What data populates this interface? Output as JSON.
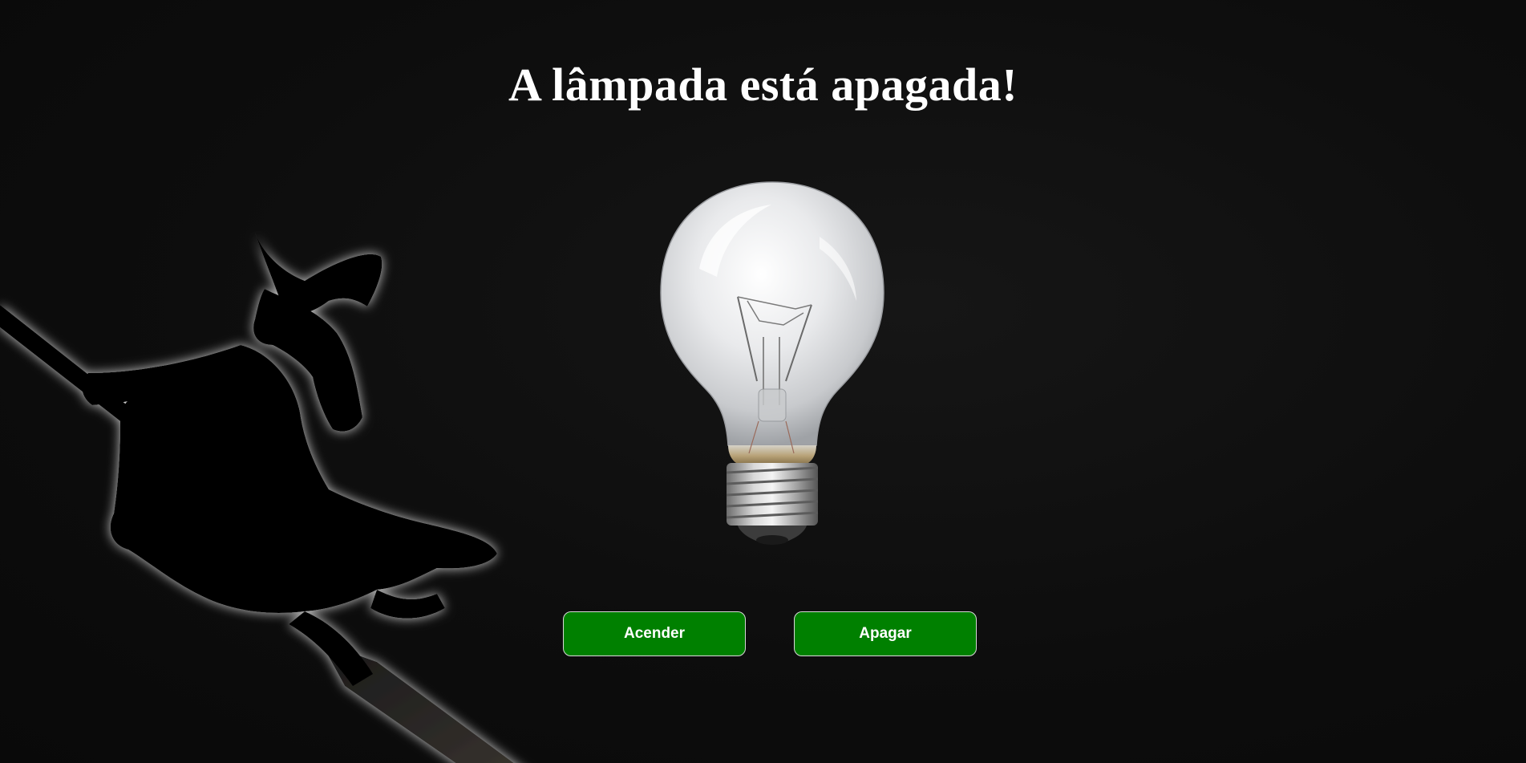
{
  "page": {
    "title": "A lâmpada está apagada!"
  },
  "bulb": {
    "icon": "light-bulb-off-icon",
    "state": "off"
  },
  "decoration": {
    "icon": "witch-on-broom-silhouette-icon"
  },
  "controls": {
    "turn_on_label": "Acender",
    "turn_off_label": "Apagar"
  },
  "colors": {
    "background": "#0d0d0d",
    "title_text": "#ffffff",
    "button_bg": "#008000",
    "button_border": "#d8d8d8",
    "button_text": "#ffffff"
  }
}
